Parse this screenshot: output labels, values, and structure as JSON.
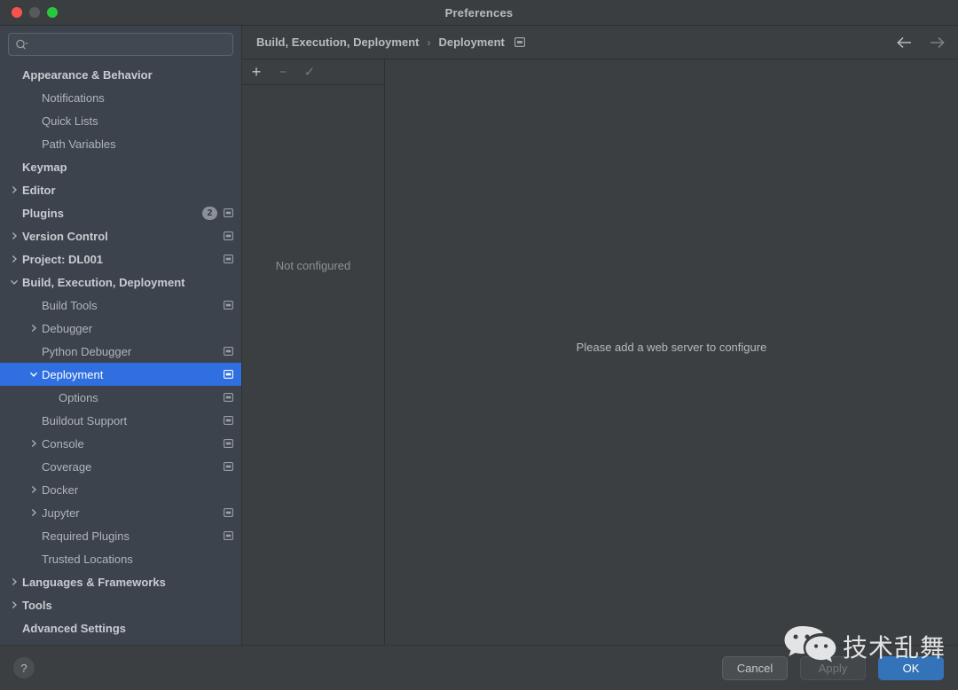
{
  "window": {
    "title": "Preferences",
    "traffic_lights": [
      "close",
      "minimize",
      "zoom"
    ]
  },
  "colors": {
    "selection_blue": "#2f6fe0",
    "primary_button": "#3573b8",
    "sidebar_bg": "#3c434d",
    "content_bg": "#3c3f41",
    "traffic_close": "#f9534f",
    "traffic_min": "#58595b",
    "traffic_zoom": "#27c93f"
  },
  "sidebar": {
    "search": {
      "placeholder": "",
      "value": "",
      "icon": "search-icon"
    },
    "items": [
      {
        "label": "Appearance & Behavior",
        "level": 0,
        "style": "top",
        "chevron": "none",
        "badge": null,
        "scope_icon": false
      },
      {
        "label": "Notifications",
        "level": 1,
        "style": "child",
        "chevron": "none",
        "badge": null,
        "scope_icon": false
      },
      {
        "label": "Quick Lists",
        "level": 1,
        "style": "child",
        "chevron": "none",
        "badge": null,
        "scope_icon": false
      },
      {
        "label": "Path Variables",
        "level": 1,
        "style": "child",
        "chevron": "none",
        "badge": null,
        "scope_icon": false
      },
      {
        "label": "Keymap",
        "level": 0,
        "style": "top",
        "chevron": "none",
        "badge": null,
        "scope_icon": false
      },
      {
        "label": "Editor",
        "level": 0,
        "style": "top",
        "chevron": "collapsed",
        "badge": null,
        "scope_icon": false
      },
      {
        "label": "Plugins",
        "level": 0,
        "style": "top",
        "chevron": "none",
        "badge": "2",
        "scope_icon": true
      },
      {
        "label": "Version Control",
        "level": 0,
        "style": "top",
        "chevron": "collapsed",
        "badge": null,
        "scope_icon": true
      },
      {
        "label": "Project: DL001",
        "level": 0,
        "style": "top",
        "chevron": "collapsed",
        "badge": null,
        "scope_icon": true
      },
      {
        "label": "Build, Execution, Deployment",
        "level": 0,
        "style": "top",
        "chevron": "expanded",
        "badge": null,
        "scope_icon": false
      },
      {
        "label": "Build Tools",
        "level": 1,
        "style": "child",
        "chevron": "none",
        "badge": null,
        "scope_icon": true
      },
      {
        "label": "Debugger",
        "level": 1,
        "style": "child",
        "chevron": "collapsed",
        "badge": null,
        "scope_icon": false
      },
      {
        "label": "Python Debugger",
        "level": 1,
        "style": "child",
        "chevron": "none",
        "badge": null,
        "scope_icon": true
      },
      {
        "label": "Deployment",
        "level": 1,
        "style": "child",
        "chevron": "expanded",
        "badge": null,
        "scope_icon": true,
        "selected": true
      },
      {
        "label": "Options",
        "level": 2,
        "style": "child",
        "chevron": "none",
        "badge": null,
        "scope_icon": true
      },
      {
        "label": "Buildout Support",
        "level": 1,
        "style": "child",
        "chevron": "none",
        "badge": null,
        "scope_icon": true
      },
      {
        "label": "Console",
        "level": 1,
        "style": "child",
        "chevron": "collapsed",
        "badge": null,
        "scope_icon": true
      },
      {
        "label": "Coverage",
        "level": 1,
        "style": "child",
        "chevron": "none",
        "badge": null,
        "scope_icon": true
      },
      {
        "label": "Docker",
        "level": 1,
        "style": "child",
        "chevron": "collapsed",
        "badge": null,
        "scope_icon": false
      },
      {
        "label": "Jupyter",
        "level": 1,
        "style": "child",
        "chevron": "collapsed",
        "badge": null,
        "scope_icon": true
      },
      {
        "label": "Required Plugins",
        "level": 1,
        "style": "child",
        "chevron": "none",
        "badge": null,
        "scope_icon": true
      },
      {
        "label": "Trusted Locations",
        "level": 1,
        "style": "child",
        "chevron": "none",
        "badge": null,
        "scope_icon": false
      },
      {
        "label": "Languages & Frameworks",
        "level": 0,
        "style": "top",
        "chevron": "collapsed",
        "badge": null,
        "scope_icon": false
      },
      {
        "label": "Tools",
        "level": 0,
        "style": "top",
        "chevron": "collapsed",
        "badge": null,
        "scope_icon": false
      },
      {
        "label": "Advanced Settings",
        "level": 0,
        "style": "top",
        "chevron": "none",
        "badge": null,
        "scope_icon": false
      }
    ]
  },
  "breadcrumb": {
    "parent": "Build, Execution, Deployment",
    "separator": "›",
    "current": "Deployment",
    "scope_icon": "project-scope-icon",
    "back_icon": "arrow-left-icon",
    "forward_icon": "arrow-right-icon"
  },
  "server_list": {
    "toolbar": [
      {
        "name": "add-server-button",
        "glyph": "+",
        "enabled": true
      },
      {
        "name": "remove-server-button",
        "glyph": "−",
        "enabled": false
      },
      {
        "name": "set-default-server-button",
        "glyph": "✓",
        "enabled": false
      }
    ],
    "empty_text": "Not configured"
  },
  "detail": {
    "empty_message": "Please add a web server to configure"
  },
  "bottom_bar": {
    "help_label": "?",
    "buttons": [
      {
        "label": "Cancel",
        "style": "normal"
      },
      {
        "label": "Apply",
        "style": "disabled"
      },
      {
        "label": "OK",
        "style": "primary"
      }
    ]
  },
  "watermark": {
    "text": "技术乱舞",
    "logo": "wechat-logo"
  }
}
